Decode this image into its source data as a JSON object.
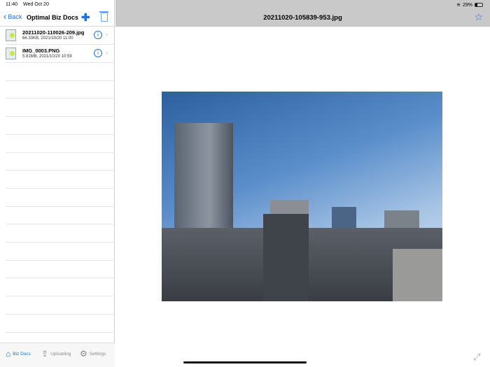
{
  "status": {
    "time": "11:40",
    "date": "Wed Oct 20",
    "battery": "29%"
  },
  "nav": {
    "back": "Back",
    "title": "Optimal Biz Docs"
  },
  "files": [
    {
      "name": "20211020-110026-209.jpg",
      "meta": "66.33KB, 2021/10/20 11:00"
    },
    {
      "name": "IMG_0003.PNG",
      "meta": "5.81MB, 2021/10/20 10:59"
    }
  ],
  "tabs": [
    {
      "label": "Biz Docs",
      "icon": "house-icon"
    },
    {
      "label": "Uploading",
      "icon": "upload-icon"
    },
    {
      "label": "Settings",
      "icon": "gear-icon"
    }
  ],
  "viewer": {
    "title": "20211020-105839-953.jpg"
  }
}
